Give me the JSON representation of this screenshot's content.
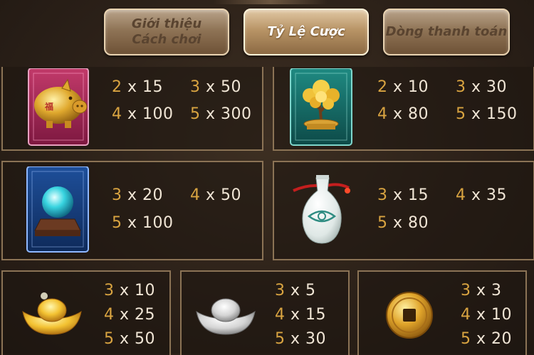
{
  "tabs": [
    {
      "label": "Giới thiệu\nCách chơi",
      "active": false
    },
    {
      "label": "Tỷ Lệ Cược",
      "active": true
    },
    {
      "label": "Dòng thanh toán",
      "active": false
    }
  ],
  "colors": {
    "panel_border": "#8b7355",
    "multiplier_number": "#d9a441",
    "multiplier_text": "#f1e6d6"
  },
  "symbols": [
    {
      "name": "golden-pig",
      "icon": "pig-icon",
      "payouts": [
        {
          "count": "2",
          "value": "15"
        },
        {
          "count": "3",
          "value": "50"
        },
        {
          "count": "4",
          "value": "100"
        },
        {
          "count": "5",
          "value": "300"
        }
      ]
    },
    {
      "name": "money-tree",
      "icon": "money-tree-icon",
      "payouts": [
        {
          "count": "2",
          "value": "10"
        },
        {
          "count": "3",
          "value": "30"
        },
        {
          "count": "4",
          "value": "80"
        },
        {
          "count": "5",
          "value": "150"
        }
      ]
    },
    {
      "name": "crystal-ball",
      "icon": "crystal-ball-icon",
      "payouts": [
        {
          "count": "3",
          "value": "20"
        },
        {
          "count": "4",
          "value": "50"
        },
        {
          "count": "5",
          "value": "100"
        }
      ]
    },
    {
      "name": "porcelain-vase",
      "icon": "vase-icon",
      "payouts": [
        {
          "count": "3",
          "value": "15"
        },
        {
          "count": "4",
          "value": "35"
        },
        {
          "count": "5",
          "value": "80"
        }
      ]
    },
    {
      "name": "gold-ingot",
      "icon": "gold-ingot-icon",
      "payouts": [
        {
          "count": "3",
          "value": "10"
        },
        {
          "count": "4",
          "value": "25"
        },
        {
          "count": "5",
          "value": "50"
        }
      ]
    },
    {
      "name": "silver-ingot",
      "icon": "silver-ingot-icon",
      "payouts": [
        {
          "count": "3",
          "value": "5"
        },
        {
          "count": "4",
          "value": "15"
        },
        {
          "count": "5",
          "value": "30"
        }
      ]
    },
    {
      "name": "gold-coin",
      "icon": "coin-icon",
      "payouts": [
        {
          "count": "3",
          "value": "3"
        },
        {
          "count": "4",
          "value": "10"
        },
        {
          "count": "5",
          "value": "20"
        }
      ]
    }
  ]
}
